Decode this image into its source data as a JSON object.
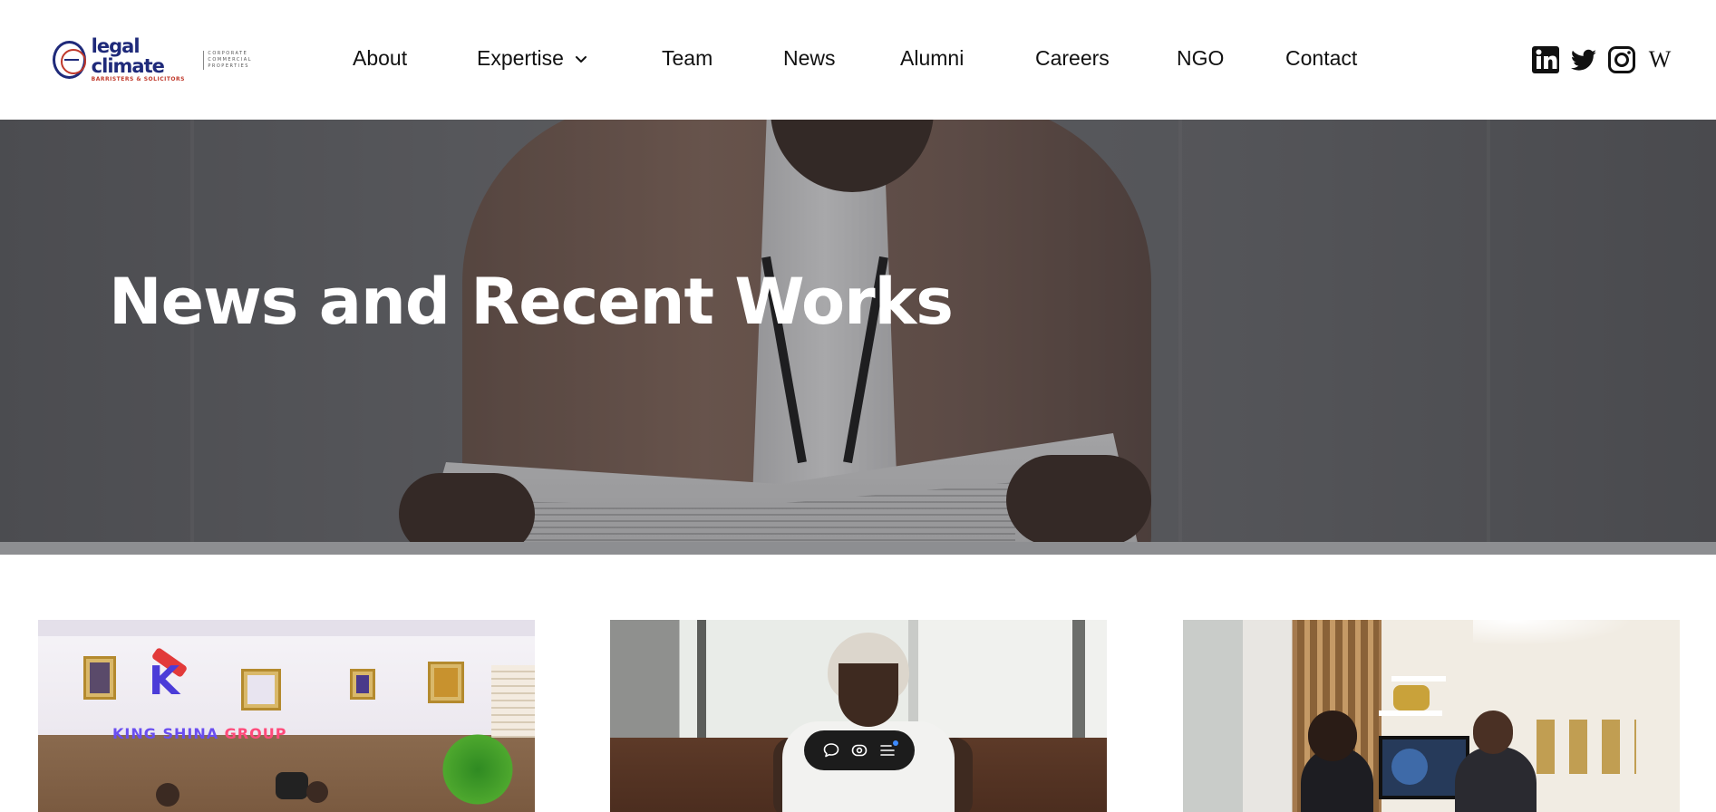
{
  "header": {
    "logo": {
      "main": "legal climate",
      "sub": "BARRISTERS & SOLICITORS",
      "side": [
        "CORPORATE",
        "COMMERCIAL",
        "PROPERTIES"
      ]
    },
    "nav": [
      {
        "label": "About"
      },
      {
        "label": "Expertise",
        "has_dropdown": true
      },
      {
        "label": "Team"
      },
      {
        "label": "News"
      },
      {
        "label": "Alumni"
      },
      {
        "label": "Careers"
      },
      {
        "label": "NGO"
      },
      {
        "label": "Contact"
      }
    ],
    "social": [
      "linkedin-icon",
      "twitter-icon",
      "instagram-icon",
      "wikipedia-icon"
    ]
  },
  "hero": {
    "title": "News and Recent Works"
  },
  "cards": [
    {
      "image": "office-reception-photo",
      "sign_text_left": "KING SHINA",
      "sign_text_right": "GROUP"
    },
    {
      "image": "woman-on-sofa-photo"
    },
    {
      "image": "office-meeting-photo"
    }
  ],
  "floating_toolbar": {
    "icons": [
      "comment-icon",
      "preview-icon",
      "menu-icon"
    ],
    "accent": "#3d8bff"
  },
  "colors": {
    "text": "#111111",
    "logo_blue": "#1f2a7a",
    "logo_red": "#c0392b",
    "hero_title": "#ffffff"
  }
}
